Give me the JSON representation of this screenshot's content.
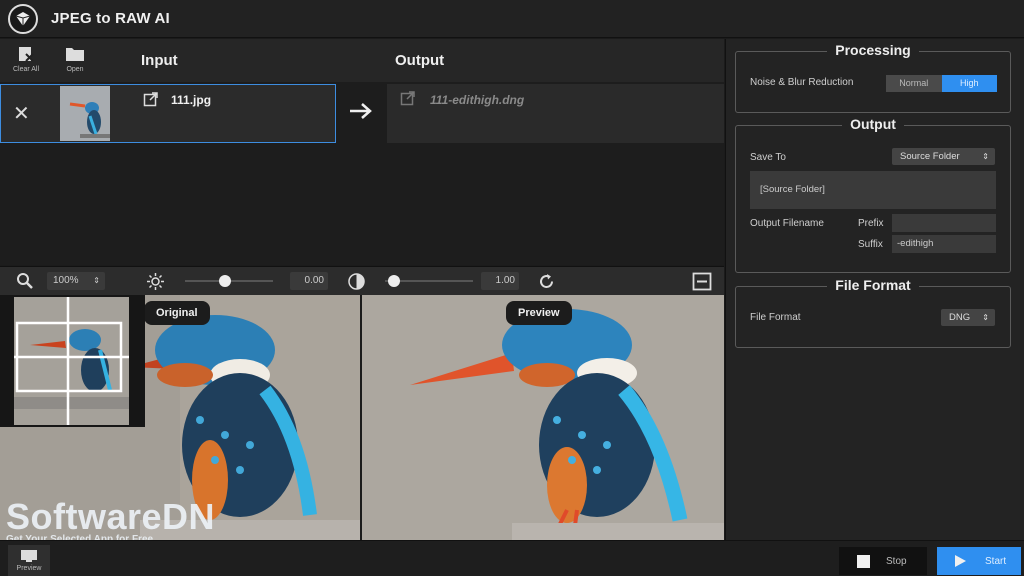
{
  "app": {
    "title": "JPEG to RAW AI"
  },
  "toolbar": {
    "clear_all": "Clear All",
    "open": "Open"
  },
  "columns": {
    "input": "Input",
    "output": "Output"
  },
  "file": {
    "input_name": "111.jpg",
    "output_name": "111-edithigh.dng"
  },
  "viewer": {
    "zoom": "100%",
    "brightness_value": "0.00",
    "contrast_value": "1.00",
    "brightness_level": 0.45,
    "contrast_level": 0.1,
    "original_label": "Original",
    "preview_label": "Preview"
  },
  "processing": {
    "title": "Processing",
    "noise_label": "Noise & Blur Reduction",
    "options": [
      "Normal",
      "High"
    ],
    "selected": "High"
  },
  "output": {
    "title": "Output",
    "save_to_label": "Save To",
    "save_to_value": "Source Folder",
    "folder_path": "[Source Folder]",
    "filename_label": "Output Filename",
    "prefix_label": "Prefix",
    "prefix_value": "",
    "suffix_label": "Suffix",
    "suffix_value": "-edithigh"
  },
  "file_format": {
    "title": "File Format",
    "label": "File Format",
    "value": "DNG"
  },
  "bottom": {
    "preview": "Preview",
    "stop": "Stop",
    "start": "Start"
  },
  "watermark": {
    "main": "SoftwareDN",
    "sub": "Get Your Selected App for Free"
  },
  "colors": {
    "accent": "#2f8ff0",
    "background": "#1b1b1b",
    "panel": "#232323"
  }
}
